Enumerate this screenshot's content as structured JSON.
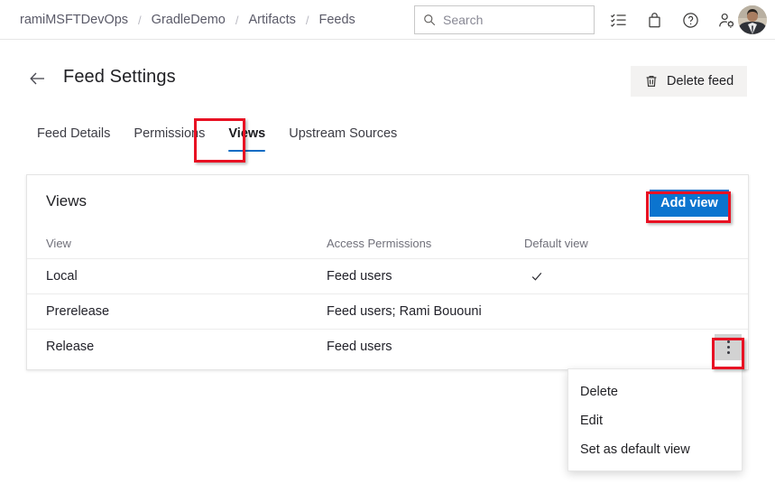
{
  "topbar": {
    "breadcrumb": [
      {
        "label": "ramiMSFTDevOps"
      },
      {
        "label": "GradleDemo"
      },
      {
        "label": "Artifacts"
      },
      {
        "label": "Feeds"
      }
    ],
    "separator": "/",
    "search": {
      "placeholder": "Search",
      "value": "",
      "icon": "search-icon"
    },
    "icons": [
      {
        "name": "tasks-checklist-icon"
      },
      {
        "name": "shopping-bag-icon"
      },
      {
        "name": "help-circle-icon"
      },
      {
        "name": "user-settings-icon"
      }
    ],
    "avatar": {
      "name": "user-avatar"
    }
  },
  "page": {
    "back_icon": "back-arrow-icon",
    "title": "Feed Settings",
    "delete_feed": {
      "label": "Delete feed",
      "icon": "trash-icon"
    }
  },
  "tabs": [
    {
      "label": "Feed Details",
      "active": false
    },
    {
      "label": "Permissions",
      "active": false
    },
    {
      "label": "Views",
      "active": true
    },
    {
      "label": "Upstream Sources",
      "active": false
    }
  ],
  "card": {
    "title": "Views",
    "add_view_label": "Add view",
    "columns": {
      "view": "View",
      "permissions": "Access Permissions",
      "default": "Default view"
    },
    "rows": [
      {
        "view": "Local",
        "permissions": "Feed users",
        "is_default": true
      },
      {
        "view": "Prerelease",
        "permissions": "Feed users; Rami Bououni",
        "is_default": false
      },
      {
        "view": "Release",
        "permissions": "Feed users",
        "is_default": false
      }
    ]
  },
  "context_menu": {
    "items": [
      {
        "label": "Delete"
      },
      {
        "label": "Edit"
      },
      {
        "label": "Set as default view"
      }
    ]
  },
  "colors": {
    "accent_blue": "#0b74cf",
    "tab_underline": "#0d6cc4",
    "annotation_red": "#e81123",
    "button_gray": "#f3f2f1",
    "kebab_gray": "#d2d2d2"
  }
}
